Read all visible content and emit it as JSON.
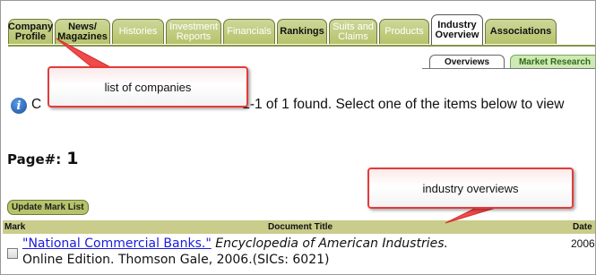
{
  "tabs": [
    {
      "label": "Company\nProfile",
      "style": "dark"
    },
    {
      "label": "News/\nMagazines",
      "style": "dark"
    },
    {
      "label": "Histories",
      "style": "light"
    },
    {
      "label": "Investment\nReports",
      "style": "light"
    },
    {
      "label": "Financials",
      "style": "light"
    },
    {
      "label": "Rankings",
      "style": "dark"
    },
    {
      "label": "Suits and\nClaims",
      "style": "light"
    },
    {
      "label": "Products",
      "style": "light"
    },
    {
      "label": "Industry\nOverview",
      "style": "active"
    },
    {
      "label": "Associations",
      "style": "dark"
    }
  ],
  "subtabs": {
    "overviews": "Overviews",
    "market_research": "Market Research"
  },
  "info": {
    "text": "C",
    "text_right": "1-1 of 1 found. Select one of the items below to view"
  },
  "page": {
    "label": "Page#:",
    "number": "1"
  },
  "update_button": "Update Mark List",
  "table": {
    "headers": {
      "mark": "Mark",
      "title": "Document Title",
      "date": "Date"
    },
    "rows": [
      {
        "link": "\"National Commercial Banks.\"",
        "source": "Encyclopedia of American Industries.",
        "line2": "Online Edition. Thomson Gale, 2006.(SICs: 6021)",
        "date": "2006"
      }
    ]
  },
  "annotations": {
    "companies": "list of companies",
    "overviews": "industry overviews"
  },
  "colors": {
    "tab_olive": "#b6c36a",
    "callout_border": "#e63a3a",
    "link": "#1a1ae0"
  }
}
